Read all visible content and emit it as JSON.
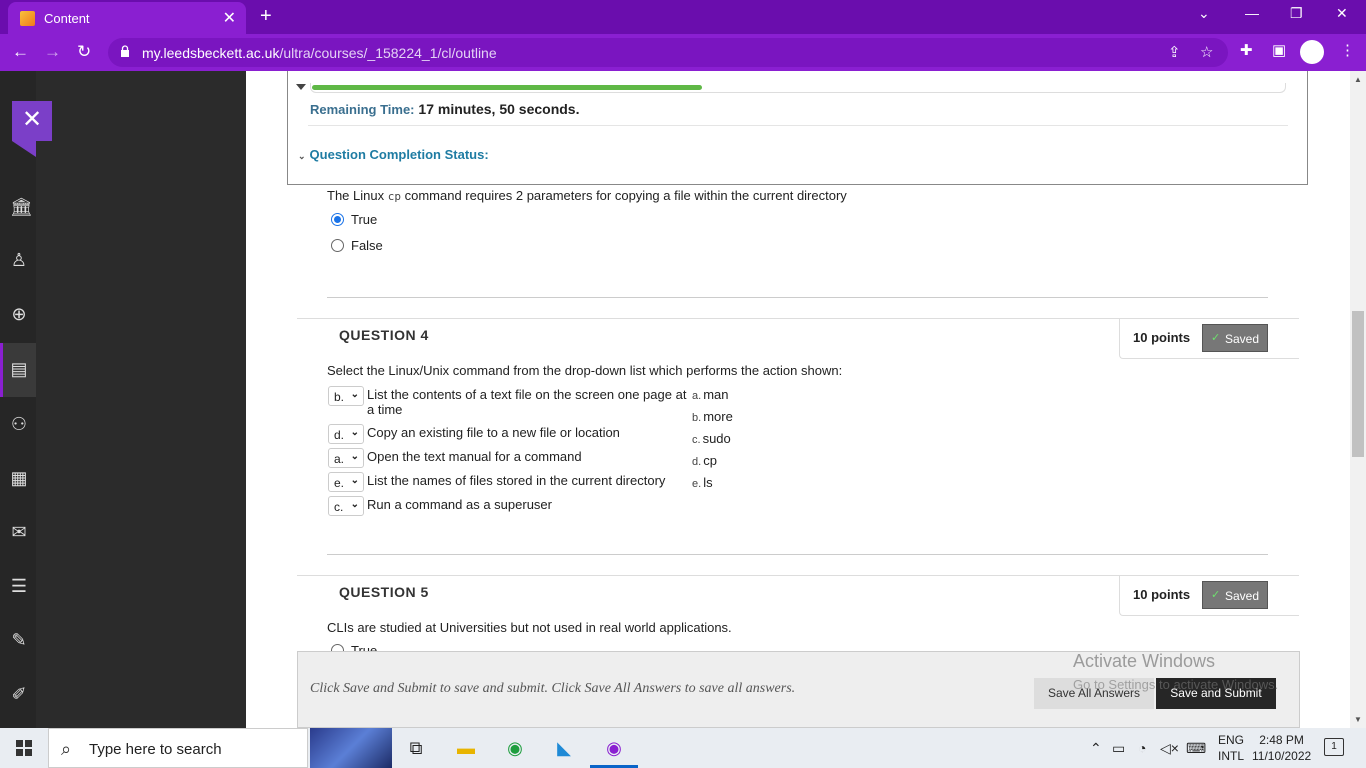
{
  "browser": {
    "tab_title": "Content",
    "url_domain": "my.leedsbeckett.ac.uk",
    "url_path": "/ultra/courses/_158224_1/cl/outline"
  },
  "exam": {
    "remaining_label": "Remaining Time:",
    "remaining_minutes": "17 minutes,",
    "remaining_seconds": "50 seconds.",
    "remaining_fraction": 0.4,
    "completion_status_label": "Question Completion Status:"
  },
  "q3": {
    "text_before": "The Linux",
    "code": "cp",
    "text_after": "command requires 2 parameters for copying a file within the current directory",
    "options": [
      {
        "label": "True",
        "checked": true
      },
      {
        "label": "False",
        "checked": false
      }
    ]
  },
  "q4": {
    "title": "QUESTION 4",
    "points": "10 points",
    "saved_label": "Saved",
    "prompt": "Select the Linux/Unix command from the drop-down list which performs the action shown:",
    "matches": [
      {
        "selected": "b.",
        "text": "List the contents of a text file on the screen one page at a time"
      },
      {
        "selected": "d.",
        "text": "Copy an existing file to a new file or location"
      },
      {
        "selected": "a.",
        "text": "Open the text manual for a command"
      },
      {
        "selected": "e.",
        "text": "List the names of files stored in the current directory"
      },
      {
        "selected": "c.",
        "text": "Run a command as a superuser"
      }
    ],
    "answers": [
      {
        "letter": "a.",
        "text": "man"
      },
      {
        "letter": "b.",
        "text": "more"
      },
      {
        "letter": "c.",
        "text": "sudo"
      },
      {
        "letter": "d.",
        "text": "cp"
      },
      {
        "letter": "e.",
        "text": "ls"
      }
    ]
  },
  "q5": {
    "title": "QUESTION 5",
    "points": "10 points",
    "saved_label": "Saved",
    "prompt": "CLIs are studied at Universities but not used in real world applications.",
    "first_option": "True"
  },
  "footer": {
    "instructions": "Click Save and Submit to save and submit. Click Save All Answers to save all answers.",
    "save_all_label": "Save All Answers",
    "submit_label": "Save and Submit"
  },
  "watermark": {
    "line1": "Activate Windows",
    "line2": "Go to Settings to activate Windows."
  },
  "taskbar": {
    "search_placeholder": "Type here to search",
    "lang_line1": "ENG",
    "lang_line2": "INTL",
    "time": "2:48 PM",
    "date": "11/10/2022",
    "notification_count": "1"
  },
  "colors": {
    "chrome_purple": "#8a1fd1",
    "progress_green": "#5fb846",
    "status_blue": "#1f7ca3"
  }
}
